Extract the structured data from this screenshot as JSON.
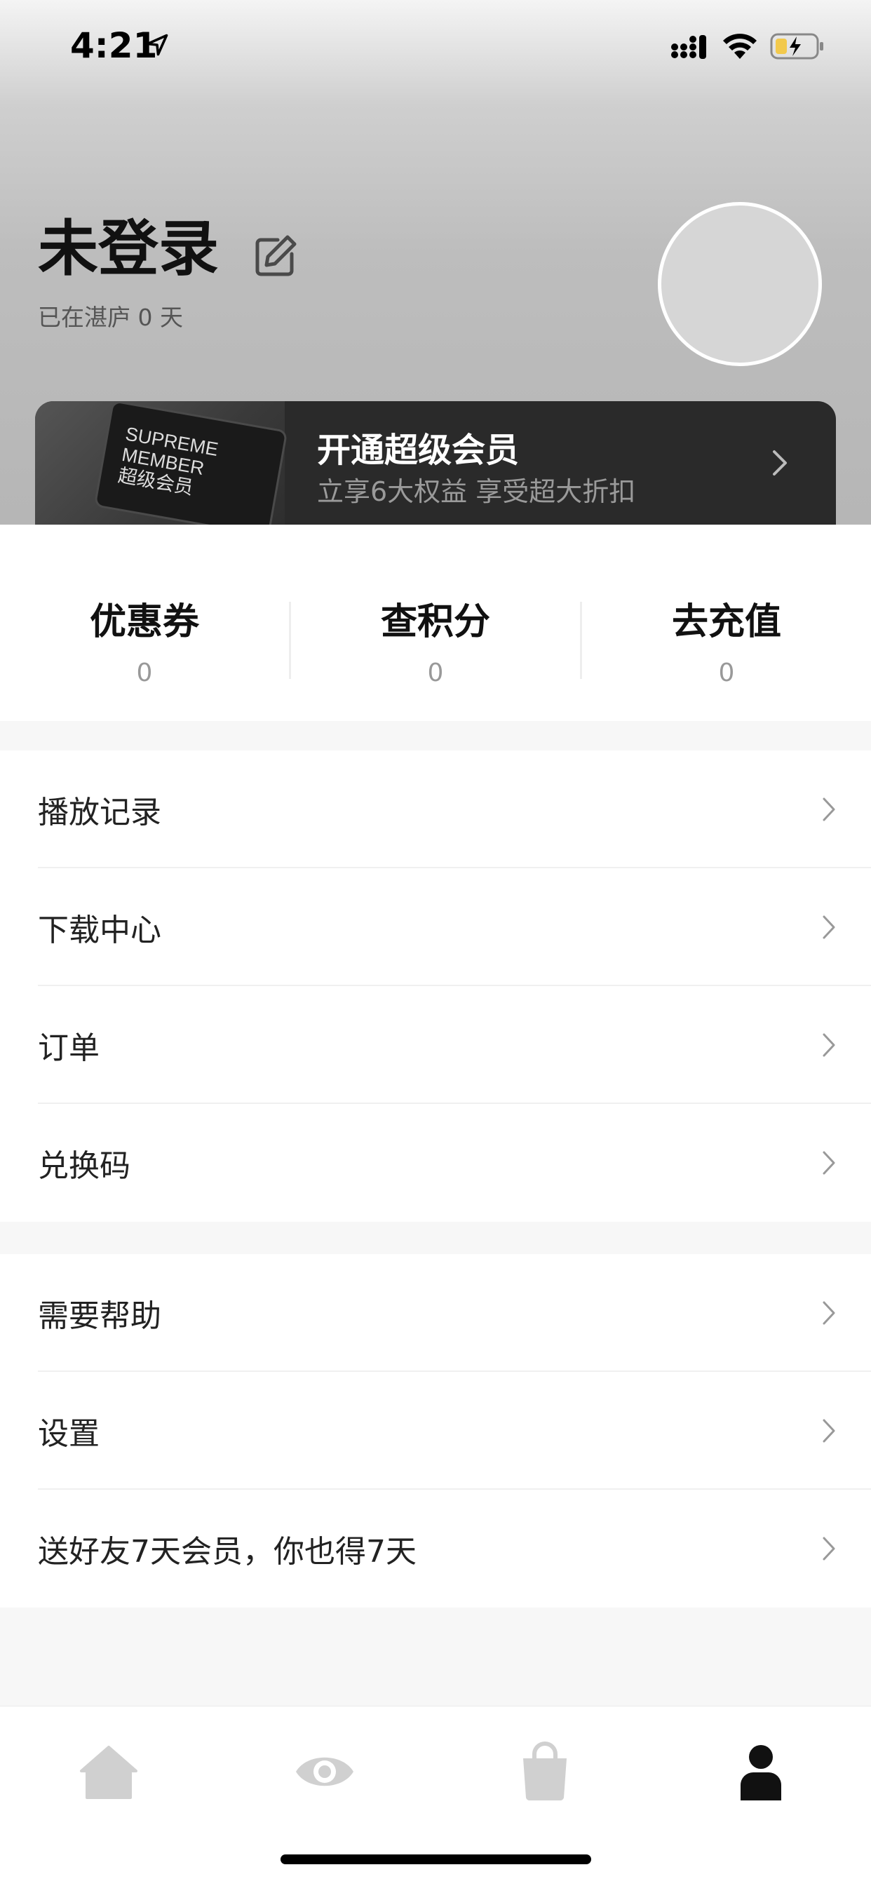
{
  "status_bar": {
    "time": "4:21"
  },
  "profile": {
    "title": "未登录",
    "days_text": "已在湛庐 0 天"
  },
  "vip_banner": {
    "card_text": [
      "SUPREME",
      "MEMBER",
      "超级会员"
    ],
    "title": "开通超级会员",
    "subtitle": "立享6大权益 享受超大折扣"
  },
  "stats": [
    {
      "label": "优惠券",
      "value": "0"
    },
    {
      "label": "查积分",
      "value": "0"
    },
    {
      "label": "去充值",
      "value": "0"
    }
  ],
  "menu_group_1": [
    {
      "label": "播放记录"
    },
    {
      "label": "下载中心"
    },
    {
      "label": "订单"
    },
    {
      "label": "兑换码"
    }
  ],
  "menu_group_2": [
    {
      "label": "需要帮助"
    },
    {
      "label": "设置"
    },
    {
      "label": "送好友7天会员，你也得7天"
    }
  ],
  "tab_bar": {
    "tabs": [
      {
        "icon": "home-icon",
        "active": false
      },
      {
        "icon": "eye-icon",
        "active": false
      },
      {
        "icon": "shopping-bag-icon",
        "active": false
      },
      {
        "icon": "person-icon",
        "active": true
      }
    ],
    "active_color": "#111111",
    "inactive_color": "#d0d0d0"
  }
}
